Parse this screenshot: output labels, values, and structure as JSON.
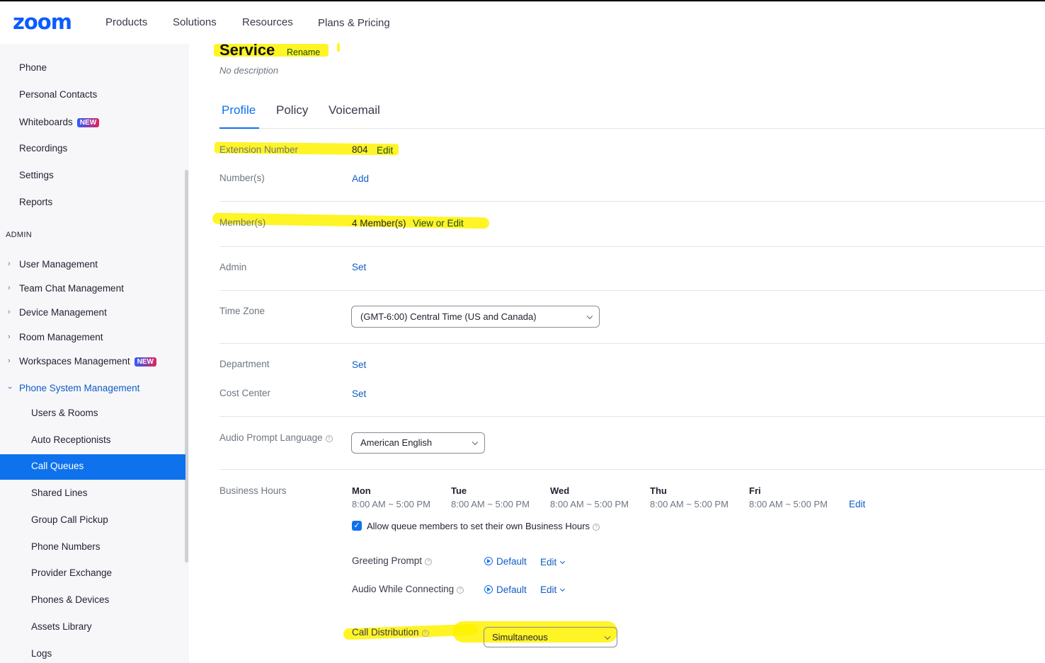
{
  "header": {
    "logo": "zoom",
    "nav": [
      "Products",
      "Solutions",
      "Resources",
      "Plans & Pricing"
    ]
  },
  "sidebar": {
    "top_items": [
      {
        "label": "Phone"
      },
      {
        "label": "Personal Contacts"
      },
      {
        "label": "Whiteboards",
        "badge": "NEW"
      },
      {
        "label": "Recordings"
      },
      {
        "label": "Settings"
      },
      {
        "label": "Reports"
      }
    ],
    "admin_heading": "ADMIN",
    "admin_items": [
      {
        "label": "User Management"
      },
      {
        "label": "Team Chat Management"
      },
      {
        "label": "Device Management"
      },
      {
        "label": "Room Management"
      },
      {
        "label": "Workspaces Management",
        "badge": "NEW"
      },
      {
        "label": "Phone System Management",
        "expanded": true
      }
    ],
    "sub_items": [
      {
        "label": "Users & Rooms"
      },
      {
        "label": "Auto Receptionists"
      },
      {
        "label": "Call Queues",
        "active": true
      },
      {
        "label": "Shared Lines"
      },
      {
        "label": "Group Call Pickup"
      },
      {
        "label": "Phone Numbers"
      },
      {
        "label": "Provider Exchange"
      },
      {
        "label": "Phones & Devices"
      },
      {
        "label": "Assets Library"
      },
      {
        "label": "Logs"
      }
    ]
  },
  "page": {
    "title": "Service",
    "rename": "Rename",
    "description": "No description",
    "tabs": [
      "Profile",
      "Policy",
      "Voicemail"
    ],
    "active_tab": "Profile"
  },
  "profile": {
    "extension": {
      "label": "Extension Number",
      "value": "804",
      "action": "Edit"
    },
    "numbers": {
      "label": "Number(s)",
      "action": "Add"
    },
    "members": {
      "label": "Member(s)",
      "value": "4 Member(s)",
      "action": "View or Edit"
    },
    "admin": {
      "label": "Admin",
      "action": "Set"
    },
    "timezone": {
      "label": "Time Zone",
      "value": "(GMT-6:00) Central Time (US and Canada)"
    },
    "department": {
      "label": "Department",
      "action": "Set"
    },
    "cost_center": {
      "label": "Cost Center",
      "action": "Set"
    },
    "audio_prompt_language": {
      "label": "Audio Prompt Language",
      "value": "American English"
    },
    "business_hours": {
      "label": "Business Hours",
      "days": [
        {
          "day": "Mon",
          "hours": "8:00 AM ~ 5:00 PM"
        },
        {
          "day": "Tue",
          "hours": "8:00 AM ~ 5:00 PM"
        },
        {
          "day": "Wed",
          "hours": "8:00 AM ~ 5:00 PM"
        },
        {
          "day": "Thu",
          "hours": "8:00 AM ~ 5:00 PM"
        },
        {
          "day": "Fri",
          "hours": "8:00 AM ~ 5:00 PM"
        }
      ],
      "action": "Edit",
      "allow_members_label": "Allow queue members to set their own Business Hours",
      "allow_members_checked": true
    },
    "greeting_prompt": {
      "label": "Greeting Prompt",
      "value": "Default",
      "action": "Edit"
    },
    "audio_while_connecting": {
      "label": "Audio While Connecting",
      "value": "Default",
      "action": "Edit"
    },
    "call_distribution": {
      "label": "Call Distribution",
      "value": "Simultaneous"
    }
  },
  "colors": {
    "brand": "#0b5cff",
    "active": "#0e72ed",
    "highlight": "#fff200"
  }
}
